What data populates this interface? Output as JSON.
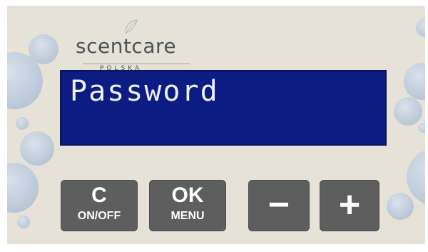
{
  "brand": {
    "name": "scentcare",
    "sub": "POLSKA"
  },
  "display": {
    "text": "Password"
  },
  "buttons": {
    "c": {
      "main": "C",
      "sub": "ON/OFF"
    },
    "ok": {
      "main": "OK",
      "sub": "MENU"
    },
    "minus": {
      "symbol": "−"
    },
    "plus": {
      "symbol": "+"
    }
  },
  "colors": {
    "panel": "#e6e2d7",
    "lcd_background": "#0c1c83",
    "lcd_text": "#eef2ff",
    "button": "#5e5e5e",
    "bubbles": "#b9c7d6"
  }
}
